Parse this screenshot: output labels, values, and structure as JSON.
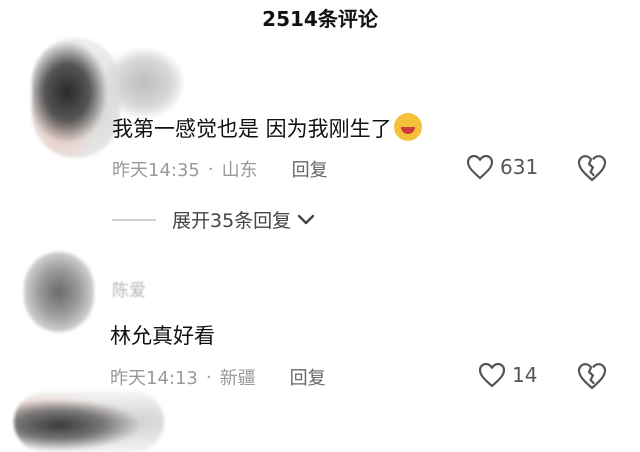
{
  "header": {
    "title": "2514条评论"
  },
  "comments": [
    {
      "username": "",
      "text": "我第一感觉也是  因为我刚生了",
      "emoji": "rolling-on-floor-laughing",
      "time": "昨天14:35",
      "location": "山东",
      "reply_label": "回复",
      "likes": "631",
      "expand_label": "展开35条回复"
    },
    {
      "username": "陈爱",
      "text": "林允真好看",
      "time": "昨天14:13",
      "location": "新疆",
      "reply_label": "回复",
      "likes": "14"
    }
  ],
  "colors": {
    "text": "#111111",
    "meta": "#9a9a9a",
    "icon": "#555555"
  },
  "icons": [
    "heart-icon",
    "broken-heart-icon",
    "chevron-down-icon"
  ]
}
